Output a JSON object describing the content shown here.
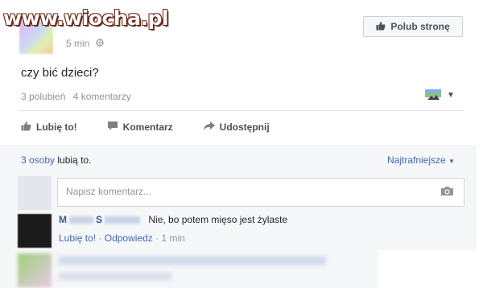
{
  "watermark": {
    "text": "www.wiocha.pl"
  },
  "post": {
    "time": "5 min",
    "text": "czy bić dzieci?",
    "likes_count": "3 polubień",
    "comments_count": "4 komentarzy"
  },
  "page_like_button": {
    "label": "Polub stronę"
  },
  "actions": {
    "like": "Lubię to!",
    "comment": "Komentarz",
    "share": "Udostępnij"
  },
  "comments_section": {
    "likes_summary_link": "3 osoby",
    "likes_summary_rest": "lubią to.",
    "sort_label": "Najtrafniejsze",
    "input_placeholder": "Napisz komentarz..."
  },
  "comments": [
    {
      "name_first": "M",
      "name_last": "S",
      "text": "Nie, bo potem mięso jest żylaste",
      "like_link": "Lubię to!",
      "reply_link": "Odpowiedz",
      "separator": "·",
      "time": "1 min"
    }
  ],
  "colors": {
    "link": "#4267b2",
    "name": "#365899",
    "muted": "#90949c"
  }
}
